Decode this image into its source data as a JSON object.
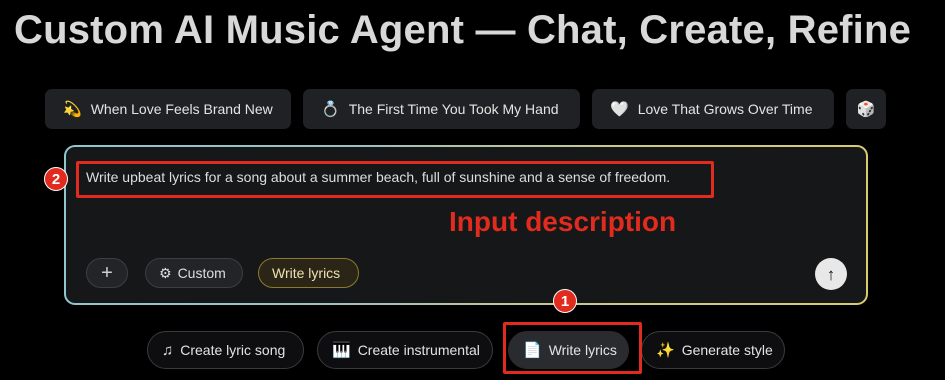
{
  "title": "Custom AI Music Agent — Chat, Create, Refine",
  "suggestions": [
    {
      "icon": "💫",
      "icon_name": "dizzy-star-icon",
      "label": "When Love Feels Brand New"
    },
    {
      "icon": "💍",
      "icon_name": "ring-icon",
      "label": "The First Time You Took My Hand"
    },
    {
      "icon": "🤍",
      "icon_name": "white-heart-icon",
      "label": "Love That Grows Over Time"
    }
  ],
  "dice": {
    "icon": "🎲",
    "icon_name": "dice-icon"
  },
  "composer": {
    "prompt": "Write upbeat lyrics for a song about a summer beach, full of sunshine and a sense of freedom.",
    "plus_icon": "+",
    "custom_label": "Custom",
    "custom_icon": "⚙",
    "write_label": "Write lyrics",
    "send_icon": "↑"
  },
  "annotations": {
    "input_label": "Input description",
    "badge_prompt": "2",
    "badge_write": "1",
    "color": "#e02b1e"
  },
  "modes": [
    {
      "icon": "♫",
      "icon_name": "music-note-icon",
      "label": "Create lyric song"
    },
    {
      "icon": "🎹",
      "icon_name": "piano-keys-icon",
      "label": "Create instrumental"
    },
    {
      "icon": "📄",
      "icon_name": "document-icon",
      "label": "Write lyrics",
      "selected": true
    },
    {
      "icon": "✨",
      "icon_name": "sparkles-icon",
      "label": "Generate style"
    }
  ]
}
